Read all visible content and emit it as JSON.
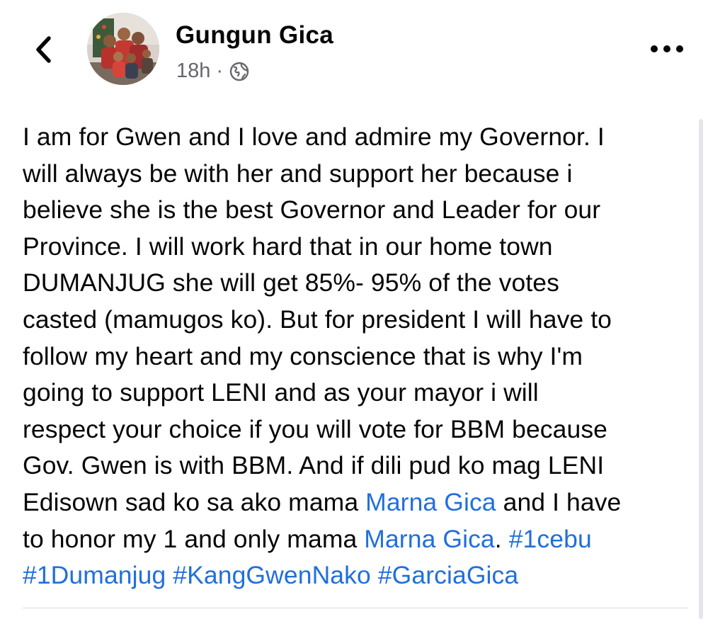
{
  "post": {
    "author_name": "Gungun Gica",
    "time_ago": "18h",
    "separator": "·",
    "privacy_icon": "globe-icon",
    "back_icon": "chevron-left-icon",
    "more_icon": "ellipsis-icon",
    "more_label": "•••",
    "lines": [
      [
        {
          "text": "I am for Gwen and I love and admire my Governor. I"
        }
      ],
      [
        {
          "text": "will always be with her and support her because i"
        }
      ],
      [
        {
          "text": "believe she is the best Governor and Leader for our"
        }
      ],
      [
        {
          "text": "Province. I will work hard that in our home town"
        }
      ],
      [
        {
          "text": "DUMANJUG she will get 85%- 95% of the votes"
        }
      ],
      [
        {
          "text": "casted (mamugos ko). But for president I will have to"
        }
      ],
      [
        {
          "text": "follow my heart and my conscience that is why I'm"
        }
      ],
      [
        {
          "text": "going to support LENI and as your mayor i will"
        }
      ],
      [
        {
          "text": "respect your choice if you will vote for BBM because"
        }
      ],
      [
        {
          "text": "Gov. Gwen is with BBM. And if dili pud ko mag LENI"
        }
      ],
      [
        {
          "text": "Edisown sad ko sa ako mama "
        },
        {
          "text": "Marna Gica",
          "link": true
        },
        {
          "text": " and I have"
        }
      ],
      [
        {
          "text": "to honor my 1 and only mama "
        },
        {
          "text": "Marna Gica",
          "link": true
        },
        {
          "text": ".  "
        },
        {
          "text": "#1cebu",
          "link": true
        }
      ],
      [
        {
          "text": "#1Dumanjug",
          "link": true
        },
        {
          "text": " "
        },
        {
          "text": "#KangGwenNako",
          "link": true
        },
        {
          "text": " "
        },
        {
          "text": "#GarciaGica",
          "link": true
        }
      ]
    ]
  },
  "colors": {
    "text": "#050505",
    "secondary_text": "#65676b",
    "link": "#216fdb",
    "divider": "#dadde1"
  }
}
